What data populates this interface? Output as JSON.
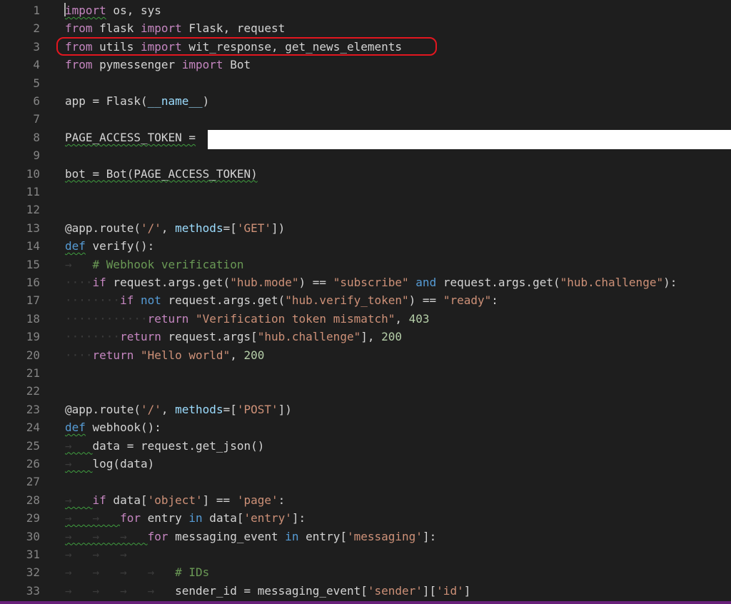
{
  "editor": {
    "line_numbers": [
      "1",
      "2",
      "3",
      "4",
      "5",
      "6",
      "7",
      "8",
      "9",
      "10",
      "11",
      "12",
      "13",
      "14",
      "15",
      "16",
      "17",
      "18",
      "19",
      "20",
      "21",
      "22",
      "23",
      "24",
      "25",
      "26",
      "27",
      "28",
      "29",
      "30",
      "31",
      "32",
      "33"
    ],
    "lines": [
      [
        [
          "kw",
          "import"
        ],
        [
          "txt",
          " os, sys"
        ]
      ],
      [
        [
          "kw",
          "from"
        ],
        [
          "txt",
          " flask "
        ],
        [
          "kw",
          "import"
        ],
        [
          "txt",
          " Flask, request"
        ]
      ],
      [
        [
          "kw",
          "from"
        ],
        [
          "txt",
          " utils "
        ],
        [
          "kw",
          "import"
        ],
        [
          "txt",
          " wit_response, get_news_elements"
        ]
      ],
      [
        [
          "kw",
          "from"
        ],
        [
          "txt",
          " pymessenger "
        ],
        [
          "kw",
          "import"
        ],
        [
          "txt",
          " Bot"
        ]
      ],
      [],
      [
        [
          "txt",
          "app = Flask("
        ],
        [
          "prm",
          "__name__"
        ],
        [
          "txt",
          ")"
        ]
      ],
      [],
      [
        [
          "txt",
          "PAGE_ACCESS_TOKEN ="
        ]
      ],
      [],
      [
        [
          "txt",
          "bot = Bot(PAGE_ACCESS_TOKEN)"
        ]
      ],
      [],
      [],
      [
        [
          "txt",
          "@app.route("
        ],
        [
          "str",
          "'/'"
        ],
        [
          "txt",
          ", "
        ],
        [
          "prm",
          "methods"
        ],
        [
          "txt",
          "=["
        ],
        [
          "str",
          "'GET'"
        ],
        [
          "txt",
          "])"
        ]
      ],
      [
        [
          "kwb",
          "def"
        ],
        [
          "txt",
          " verify():"
        ]
      ],
      [
        [
          "ws",
          "→   "
        ],
        [
          "cm",
          "# Webhook verification"
        ]
      ],
      [
        [
          "ws",
          "····"
        ],
        [
          "kw",
          "if"
        ],
        [
          "txt",
          " request.args.get("
        ],
        [
          "str",
          "\"hub.mode\""
        ],
        [
          "txt",
          ") == "
        ],
        [
          "str",
          "\"subscribe\""
        ],
        [
          "txt",
          " "
        ],
        [
          "kwb",
          "and"
        ],
        [
          "txt",
          " request.args.get("
        ],
        [
          "str",
          "\"hub.challenge\""
        ],
        [
          "txt",
          "):"
        ]
      ],
      [
        [
          "ws",
          "········"
        ],
        [
          "kw",
          "if"
        ],
        [
          "txt",
          " "
        ],
        [
          "kwb",
          "not"
        ],
        [
          "txt",
          " request.args.get("
        ],
        [
          "str",
          "\"hub.verify_token\""
        ],
        [
          "txt",
          ") == "
        ],
        [
          "str",
          "\"ready\""
        ],
        [
          "txt",
          ":"
        ]
      ],
      [
        [
          "ws",
          "············"
        ],
        [
          "kw",
          "return"
        ],
        [
          "txt",
          " "
        ],
        [
          "str",
          "\"Verification token mismatch\""
        ],
        [
          "txt",
          ", "
        ],
        [
          "num",
          "403"
        ]
      ],
      [
        [
          "ws",
          "········"
        ],
        [
          "kw",
          "return"
        ],
        [
          "txt",
          " request.args["
        ],
        [
          "str",
          "\"hub.challenge\""
        ],
        [
          "txt",
          "], "
        ],
        [
          "num",
          "200"
        ]
      ],
      [
        [
          "ws",
          "····"
        ],
        [
          "kw",
          "return"
        ],
        [
          "txt",
          " "
        ],
        [
          "str",
          "\"Hello world\""
        ],
        [
          "txt",
          ", "
        ],
        [
          "num",
          "200"
        ]
      ],
      [],
      [],
      [
        [
          "txt",
          "@app.route("
        ],
        [
          "str",
          "'/'"
        ],
        [
          "txt",
          ", "
        ],
        [
          "prm",
          "methods"
        ],
        [
          "txt",
          "=["
        ],
        [
          "str",
          "'POST'"
        ],
        [
          "txt",
          "])"
        ]
      ],
      [
        [
          "kwb",
          "def"
        ],
        [
          "txt",
          " webhook():"
        ]
      ],
      [
        [
          "ws",
          "→   "
        ],
        [
          "txt",
          "data = request.get_json()"
        ]
      ],
      [
        [
          "ws",
          "→   "
        ],
        [
          "txt",
          "log(data)"
        ]
      ],
      [],
      [
        [
          "ws",
          "→   "
        ],
        [
          "kw",
          "if"
        ],
        [
          "txt",
          " data["
        ],
        [
          "str",
          "'object'"
        ],
        [
          "txt",
          "] == "
        ],
        [
          "str",
          "'page'"
        ],
        [
          "txt",
          ":"
        ]
      ],
      [
        [
          "ws",
          "→   →   "
        ],
        [
          "kw",
          "for"
        ],
        [
          "txt",
          " entry "
        ],
        [
          "kwb",
          "in"
        ],
        [
          "txt",
          " data["
        ],
        [
          "str",
          "'entry'"
        ],
        [
          "txt",
          "]:"
        ]
      ],
      [
        [
          "ws",
          "→   →   →   "
        ],
        [
          "kw",
          "for"
        ],
        [
          "txt",
          " messaging_event "
        ],
        [
          "kwb",
          "in"
        ],
        [
          "txt",
          " entry["
        ],
        [
          "str",
          "'messaging'"
        ],
        [
          "txt",
          "]:"
        ]
      ],
      [
        [
          "ws",
          "→   →   →"
        ]
      ],
      [
        [
          "ws",
          "→   →   →   →   "
        ],
        [
          "cm",
          "# IDs"
        ]
      ],
      [
        [
          "ws",
          "→   →   →   →   "
        ],
        [
          "txt",
          "sender_id = messaging_event["
        ],
        [
          "str",
          "'sender'"
        ],
        [
          "txt",
          "]["
        ],
        [
          "str",
          "'id'"
        ],
        [
          "txt",
          "]"
        ]
      ]
    ]
  }
}
